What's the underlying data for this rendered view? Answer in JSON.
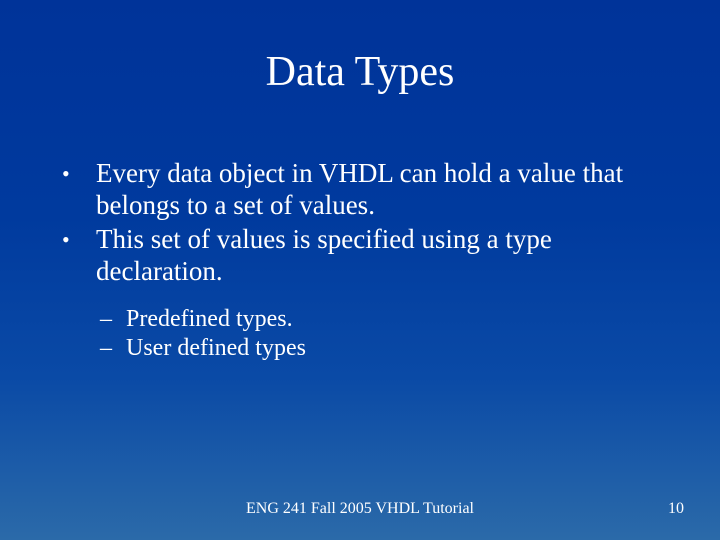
{
  "title": "Data Types",
  "bullets": [
    "Every data object in VHDL can hold a value that belongs to a set of values.",
    "This set of values is specified using a type declaration."
  ],
  "subbullets": [
    "Predefined types.",
    "User defined types"
  ],
  "footer": {
    "center": "ENG 241 Fall 2005 VHDL Tutorial",
    "pageNumber": "10"
  }
}
